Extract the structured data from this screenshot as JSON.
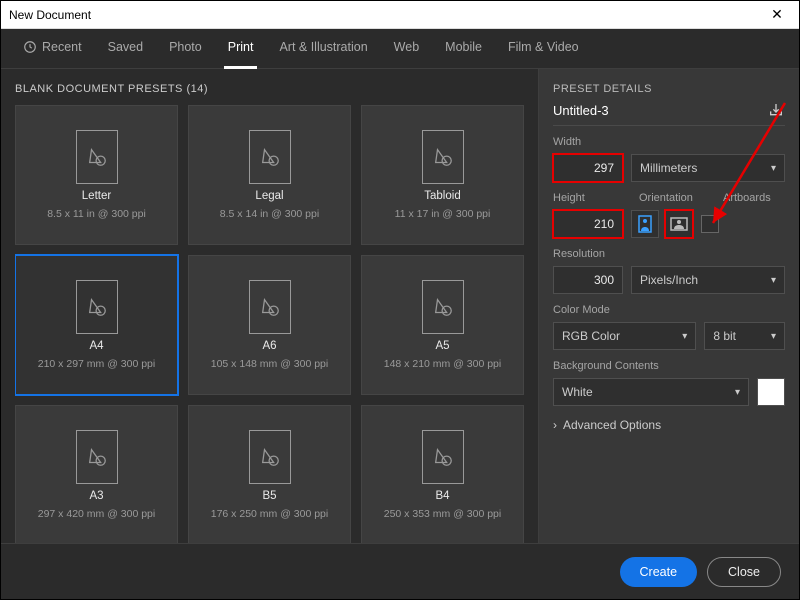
{
  "window": {
    "title": "New Document"
  },
  "tabs": [
    "Recent",
    "Saved",
    "Photo",
    "Print",
    "Art & Illustration",
    "Web",
    "Mobile",
    "Film & Video"
  ],
  "active_tab": 3,
  "left": {
    "header": "BLANK DOCUMENT PRESETS",
    "count": "(14)",
    "selected_index": 3,
    "presets": [
      {
        "name": "Letter",
        "meta": "8.5 x 11 in @ 300 ppi"
      },
      {
        "name": "Legal",
        "meta": "8.5 x 14 in @ 300 ppi"
      },
      {
        "name": "Tabloid",
        "meta": "11 x 17 in @ 300 ppi"
      },
      {
        "name": "A4",
        "meta": "210 x 297 mm @ 300 ppi"
      },
      {
        "name": "A6",
        "meta": "105 x 148 mm @ 300 ppi"
      },
      {
        "name": "A5",
        "meta": "148 x 210 mm @ 300 ppi"
      },
      {
        "name": "A3",
        "meta": "297 x 420 mm @ 300 ppi"
      },
      {
        "name": "B5",
        "meta": "176 x 250 mm @ 300 ppi"
      },
      {
        "name": "B4",
        "meta": "250 x 353 mm @ 300 ppi"
      }
    ]
  },
  "details": {
    "section_title": "PRESET DETAILS",
    "doc_name": "Untitled-3",
    "width_label": "Width",
    "width_value": "297",
    "units": "Millimeters",
    "height_label": "Height",
    "height_value": "210",
    "orientation_label": "Orientation",
    "orientation": "landscape",
    "artboards_label": "Artboards",
    "artboards_checked": false,
    "resolution_label": "Resolution",
    "resolution_value": "300",
    "resolution_units": "Pixels/Inch",
    "colormode_label": "Color Mode",
    "colormode": "RGB Color",
    "depth": "8 bit",
    "bg_label": "Background Contents",
    "bg": "White",
    "bg_swatch": "#ffffff",
    "advanced_label": "Advanced Options"
  },
  "footer": {
    "create": "Create",
    "close": "Close"
  },
  "annotations": {
    "highlight_color": "#e60000",
    "arrow_color": "#e60000",
    "highlighted": [
      "width_value",
      "height_value",
      "orientation_landscape"
    ]
  }
}
